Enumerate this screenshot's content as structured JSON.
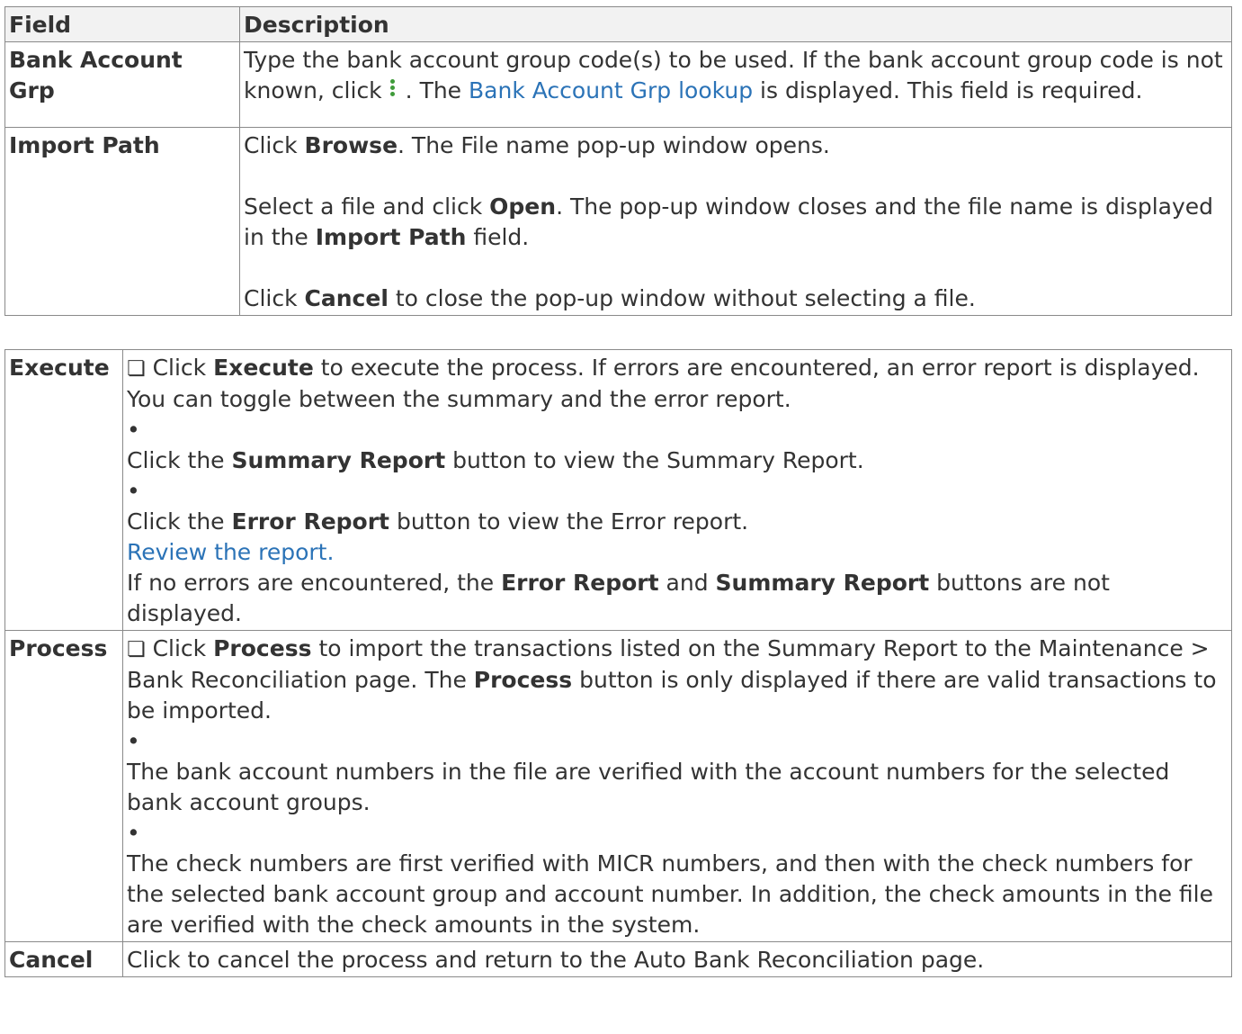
{
  "table1": {
    "header": {
      "field": "Field",
      "description": "Description"
    },
    "rows": [
      {
        "field": "Bank Account Grp",
        "desc_part1": "Type the bank account group code(s) to be used. If the bank account group code is not known, click",
        "desc_part2": ". The",
        "link": "Bank Account Grp lookup",
        "desc_part3": "is displayed. This field is required."
      },
      {
        "field": "Import Path",
        "p1_a": "Click",
        "p1_b": "Browse",
        "p1_c": ". The File name pop-up window opens.",
        "p2_a": "Select a file and click",
        "p2_b": "Open",
        "p2_c": ". The pop-up window closes and the file name is displayed in the",
        "p2_d": "Import Path",
        "p2_e": "field.",
        "p3_a": "Click",
        "p3_b": "Cancel",
        "p3_c": "to close the pop-up window without selecting a file."
      }
    ]
  },
  "table2": {
    "execute": {
      "field": "Execute",
      "checkbox": "❏",
      "l1_a": "Click",
      "l1_b": "Execute",
      "l1_c": "to execute the process. If errors are encountered, an error report is displayed.",
      "l2": "You can toggle between the summary and the error report.",
      "bullet": "•",
      "l3_a": "Click the",
      "l3_b": "Summary Report",
      "l3_c": "button to view the Summary Report.",
      "l4_a": "Click the",
      "l4_b": "Error Report",
      "l4_c": "button to view the Error report.",
      "link": "Review the report.",
      "l5_a": "If no errors are encountered, the",
      "l5_b": "Error Report",
      "l5_c": "and",
      "l5_d": "Summary Report",
      "l5_e": "buttons are not displayed."
    },
    "process": {
      "field": "Process",
      "checkbox": "❏",
      "l1_a": "Click",
      "l1_b": "Process",
      "l1_c": "to import the transactions listed on the Summary Report to the Maintenance > Bank Reconciliation page. The",
      "l1_d": "Process",
      "l1_e": "button is only displayed if there are valid transactions to be imported.",
      "bullet": "•",
      "l2": "The bank account numbers in the file are verified with the account numbers for the selected bank account groups.",
      "l3": "The check numbers are first verified with MICR numbers, and then with the check numbers for the selected bank account group and account number. In addition, the check amounts in the file are verified with the check amounts in the system."
    },
    "cancel": {
      "field": "Cancel",
      "desc": "Click to cancel the process and return to the Auto Bank Reconciliation page."
    }
  },
  "colors": {
    "link": "#2b73b7",
    "icon": "#3f9b3a",
    "border": "#8a8a8a",
    "header_bg": "#f2f2f2"
  }
}
